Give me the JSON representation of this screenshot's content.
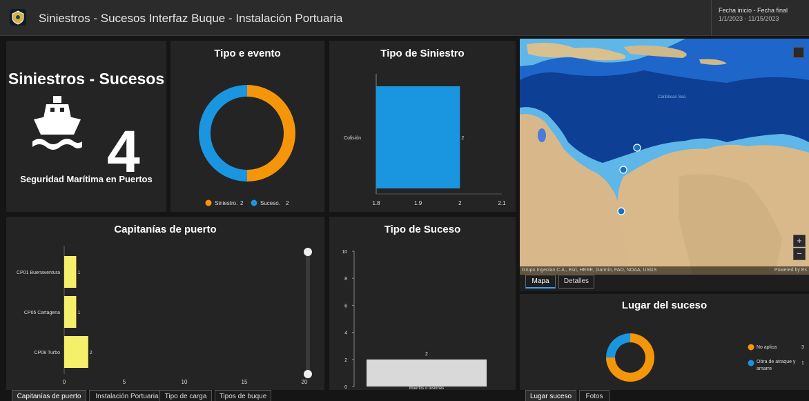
{
  "header": {
    "title": "Siniestros - Sucesos Interfaz Buque - Instalación Portuaria",
    "date_label": "Fecha inicio - Fecha final",
    "date_value": "1/1/2023 - 11/15/2023"
  },
  "kpi": {
    "title": "Siniestros - Sucesos",
    "value": "4",
    "subtitle": "Seguridad Marítima en Puertos",
    "icon": "ship-icon"
  },
  "tipo_evento": {
    "title": "Tipo e evento",
    "chart_data": {
      "type": "pie",
      "labels": [
        "Siniestro.",
        "Suceso."
      ],
      "values": [
        2,
        2
      ],
      "colors": [
        "#f5960a",
        "#1a95e0"
      ],
      "legend": "bottom"
    }
  },
  "tipo_siniestro": {
    "title": "Tipo de Siniestro",
    "chart_data": {
      "type": "bar",
      "orientation": "horizontal",
      "categories": [
        "Colisión"
      ],
      "values": [
        2
      ],
      "xlim": [
        1.8,
        2.1
      ],
      "xticks": [
        "1.8",
        "1.9",
        "2",
        "2.1"
      ],
      "color": "#1a95e0"
    }
  },
  "capitanias": {
    "title": "Capitanías de puerto",
    "chart_data": {
      "type": "bar",
      "orientation": "horizontal",
      "categories": [
        "CP01 Buenaventura",
        "CP05 Cartagena",
        "CP08 Turbo"
      ],
      "values": [
        1,
        1,
        2
      ],
      "xlim": [
        0,
        20
      ],
      "xticks": [
        "0",
        "5",
        "10",
        "15",
        "20"
      ],
      "color": "#f5f06a"
    }
  },
  "tipo_suceso": {
    "title": "Tipo de Suceso",
    "chart_data": {
      "type": "bar",
      "categories": [
        "Muertos o lesiones"
      ],
      "values": [
        2
      ],
      "ylim": [
        0,
        10
      ],
      "yticks": [
        "0",
        "2",
        "4",
        "6",
        "8",
        "10"
      ],
      "color": "#d9d9d9"
    }
  },
  "map": {
    "attribution": "Grupo Ingeolan C.A., Esri, HERE, Garmin, FAO, NOAA, USGS",
    "powered": "Powered by Es",
    "sea_label": "Caribbean Sea",
    "tabs": [
      "Mapa",
      "Detalles"
    ],
    "zoom_in": "+",
    "zoom_out": "−"
  },
  "lugar": {
    "title": "Lugar del suceso",
    "chart_data": {
      "type": "pie",
      "labels": [
        "No aplica",
        "Obra de atraque y amarre"
      ],
      "values": [
        3,
        1
      ],
      "colors": [
        "#f5960a",
        "#1a95e0"
      ],
      "legend": "right"
    }
  },
  "bottom_tabs_left": [
    "Capitanías de puerto",
    "Instalación Portuaria",
    "Tipo de carga",
    "Tipos de buque"
  ],
  "bottom_tabs_right": [
    "Lugar suceso",
    "Fotos"
  ],
  "colors": {
    "accent": "#1a95e0",
    "orange": "#f5960a",
    "yellow": "#f5f06a"
  }
}
